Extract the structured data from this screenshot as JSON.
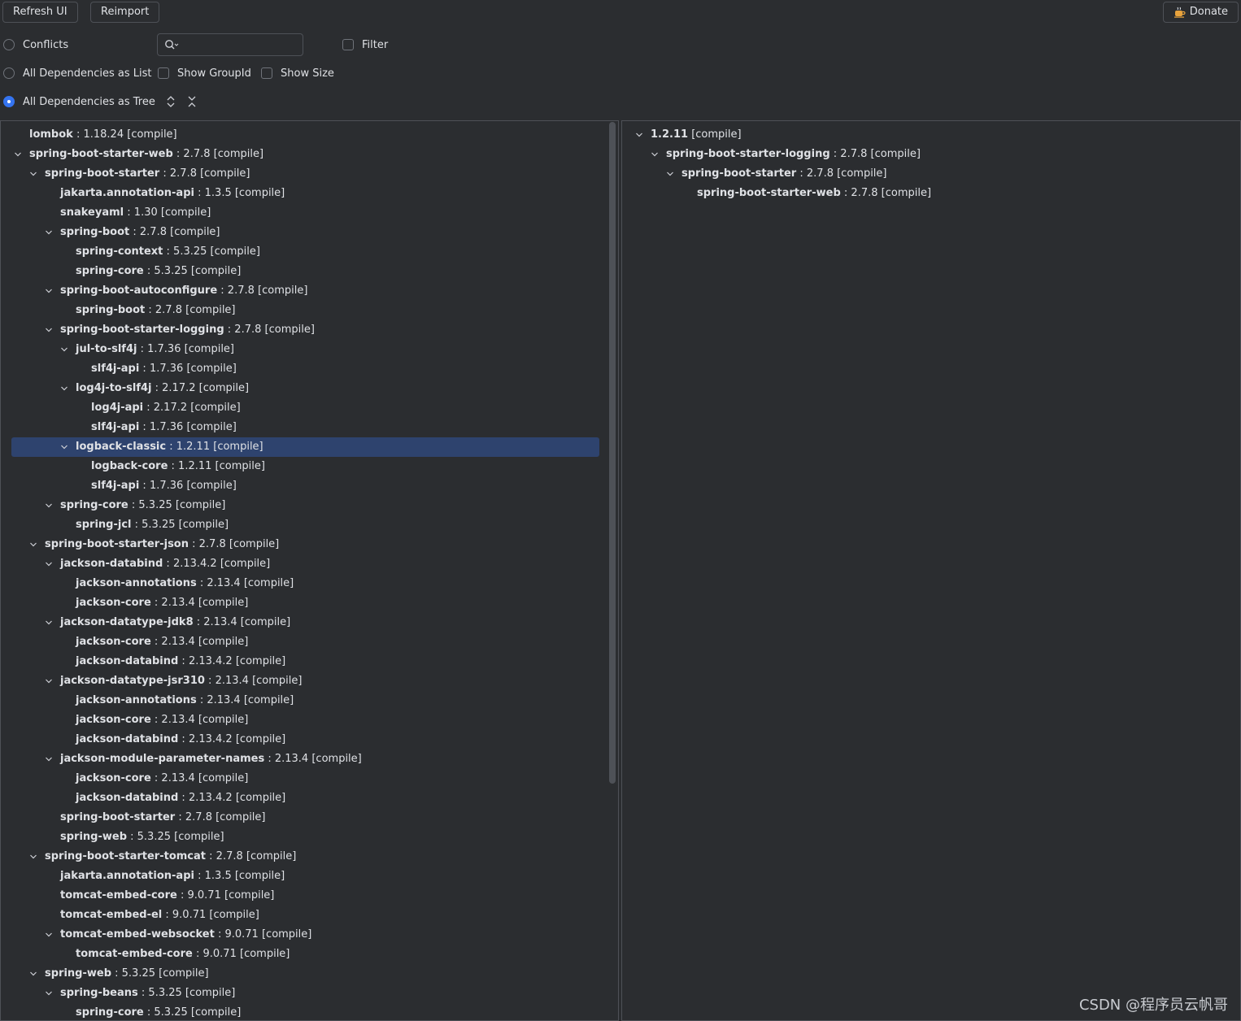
{
  "toolbar": {
    "refresh_label": "Refresh UI",
    "reimport_label": "Reimport",
    "donate_label": "Donate",
    "donate_icon": "coffee-icon"
  },
  "options": {
    "conflicts_label": "Conflicts",
    "filter_label": "Filter",
    "list_label": "All Dependencies as List",
    "show_groupid_label": "Show GroupId",
    "show_size_label": "Show Size",
    "tree_label": "All Dependencies as Tree",
    "selected_mode": "All Dependencies as Tree",
    "search_value": ""
  },
  "colors": {
    "background": "#2b2d30",
    "selection": "#2e436e",
    "accent": "#3574f0"
  },
  "left_tree": [
    {
      "name": "lombok",
      "version": "1.18.24",
      "scope": "[compile]",
      "depth": 0,
      "expanded": false
    },
    {
      "name": "spring-boot-starter-web",
      "version": "2.7.8",
      "scope": "[compile]",
      "depth": 0,
      "expanded": true
    },
    {
      "name": "spring-boot-starter",
      "version": "2.7.8",
      "scope": "[compile]",
      "depth": 1,
      "expanded": true
    },
    {
      "name": "jakarta.annotation-api",
      "version": "1.3.5",
      "scope": "[compile]",
      "depth": 2,
      "expanded": false
    },
    {
      "name": "snakeyaml",
      "version": "1.30",
      "scope": "[compile]",
      "depth": 2,
      "expanded": false
    },
    {
      "name": "spring-boot",
      "version": "2.7.8",
      "scope": "[compile]",
      "depth": 2,
      "expanded": true
    },
    {
      "name": "spring-context",
      "version": "5.3.25",
      "scope": "[compile]",
      "depth": 3,
      "expanded": false
    },
    {
      "name": "spring-core",
      "version": "5.3.25",
      "scope": "[compile]",
      "depth": 3,
      "expanded": false
    },
    {
      "name": "spring-boot-autoconfigure",
      "version": "2.7.8",
      "scope": "[compile]",
      "depth": 2,
      "expanded": true
    },
    {
      "name": "spring-boot",
      "version": "2.7.8",
      "scope": "[compile]",
      "depth": 3,
      "expanded": false
    },
    {
      "name": "spring-boot-starter-logging",
      "version": "2.7.8",
      "scope": "[compile]",
      "depth": 2,
      "expanded": true
    },
    {
      "name": "jul-to-slf4j",
      "version": "1.7.36",
      "scope": "[compile]",
      "depth": 3,
      "expanded": true
    },
    {
      "name": "slf4j-api",
      "version": "1.7.36",
      "scope": "[compile]",
      "depth": 4,
      "expanded": false
    },
    {
      "name": "log4j-to-slf4j",
      "version": "2.17.2",
      "scope": "[compile]",
      "depth": 3,
      "expanded": true
    },
    {
      "name": "log4j-api",
      "version": "2.17.2",
      "scope": "[compile]",
      "depth": 4,
      "expanded": false
    },
    {
      "name": "slf4j-api",
      "version": "1.7.36",
      "scope": "[compile]",
      "depth": 4,
      "expanded": false
    },
    {
      "name": "logback-classic",
      "version": "1.2.11",
      "scope": "[compile]",
      "depth": 3,
      "expanded": true,
      "selected": true
    },
    {
      "name": "logback-core",
      "version": "1.2.11",
      "scope": "[compile]",
      "depth": 4,
      "expanded": false
    },
    {
      "name": "slf4j-api",
      "version": "1.7.36",
      "scope": "[compile]",
      "depth": 4,
      "expanded": false
    },
    {
      "name": "spring-core",
      "version": "5.3.25",
      "scope": "[compile]",
      "depth": 2,
      "expanded": true
    },
    {
      "name": "spring-jcl",
      "version": "5.3.25",
      "scope": "[compile]",
      "depth": 3,
      "expanded": false
    },
    {
      "name": "spring-boot-starter-json",
      "version": "2.7.8",
      "scope": "[compile]",
      "depth": 1,
      "expanded": true
    },
    {
      "name": "jackson-databind",
      "version": "2.13.4.2",
      "scope": "[compile]",
      "depth": 2,
      "expanded": true
    },
    {
      "name": "jackson-annotations",
      "version": "2.13.4",
      "scope": "[compile]",
      "depth": 3,
      "expanded": false
    },
    {
      "name": "jackson-core",
      "version": "2.13.4",
      "scope": "[compile]",
      "depth": 3,
      "expanded": false
    },
    {
      "name": "jackson-datatype-jdk8",
      "version": "2.13.4",
      "scope": "[compile]",
      "depth": 2,
      "expanded": true
    },
    {
      "name": "jackson-core",
      "version": "2.13.4",
      "scope": "[compile]",
      "depth": 3,
      "expanded": false
    },
    {
      "name": "jackson-databind",
      "version": "2.13.4.2",
      "scope": "[compile]",
      "depth": 3,
      "expanded": false
    },
    {
      "name": "jackson-datatype-jsr310",
      "version": "2.13.4",
      "scope": "[compile]",
      "depth": 2,
      "expanded": true
    },
    {
      "name": "jackson-annotations",
      "version": "2.13.4",
      "scope": "[compile]",
      "depth": 3,
      "expanded": false
    },
    {
      "name": "jackson-core",
      "version": "2.13.4",
      "scope": "[compile]",
      "depth": 3,
      "expanded": false
    },
    {
      "name": "jackson-databind",
      "version": "2.13.4.2",
      "scope": "[compile]",
      "depth": 3,
      "expanded": false
    },
    {
      "name": "jackson-module-parameter-names",
      "version": "2.13.4",
      "scope": "[compile]",
      "depth": 2,
      "expanded": true
    },
    {
      "name": "jackson-core",
      "version": "2.13.4",
      "scope": "[compile]",
      "depth": 3,
      "expanded": false
    },
    {
      "name": "jackson-databind",
      "version": "2.13.4.2",
      "scope": "[compile]",
      "depth": 3,
      "expanded": false
    },
    {
      "name": "spring-boot-starter",
      "version": "2.7.8",
      "scope": "[compile]",
      "depth": 2,
      "expanded": false
    },
    {
      "name": "spring-web",
      "version": "5.3.25",
      "scope": "[compile]",
      "depth": 2,
      "expanded": false
    },
    {
      "name": "spring-boot-starter-tomcat",
      "version": "2.7.8",
      "scope": "[compile]",
      "depth": 1,
      "expanded": true
    },
    {
      "name": "jakarta.annotation-api",
      "version": "1.3.5",
      "scope": "[compile]",
      "depth": 2,
      "expanded": false
    },
    {
      "name": "tomcat-embed-core",
      "version": "9.0.71",
      "scope": "[compile]",
      "depth": 2,
      "expanded": false
    },
    {
      "name": "tomcat-embed-el",
      "version": "9.0.71",
      "scope": "[compile]",
      "depth": 2,
      "expanded": false
    },
    {
      "name": "tomcat-embed-websocket",
      "version": "9.0.71",
      "scope": "[compile]",
      "depth": 2,
      "expanded": true
    },
    {
      "name": "tomcat-embed-core",
      "version": "9.0.71",
      "scope": "[compile]",
      "depth": 3,
      "expanded": false
    },
    {
      "name": "spring-web",
      "version": "5.3.25",
      "scope": "[compile]",
      "depth": 1,
      "expanded": true
    },
    {
      "name": "spring-beans",
      "version": "5.3.25",
      "scope": "[compile]",
      "depth": 2,
      "expanded": true
    },
    {
      "name": "spring-core",
      "version": "5.3.25",
      "scope": "[compile]",
      "depth": 3,
      "expanded": false
    }
  ],
  "right_tree": [
    {
      "name": "1.2.11",
      "version": "",
      "scope": "[compile]",
      "depth": 0,
      "expanded": true
    },
    {
      "name": "spring-boot-starter-logging",
      "version": "2.7.8",
      "scope": "[compile]",
      "depth": 1,
      "expanded": true
    },
    {
      "name": "spring-boot-starter",
      "version": "2.7.8",
      "scope": "[compile]",
      "depth": 2,
      "expanded": true
    },
    {
      "name": "spring-boot-starter-web",
      "version": "2.7.8",
      "scope": "[compile]",
      "depth": 3,
      "expanded": false
    }
  ],
  "watermark": "CSDN @程序员云帆哥"
}
